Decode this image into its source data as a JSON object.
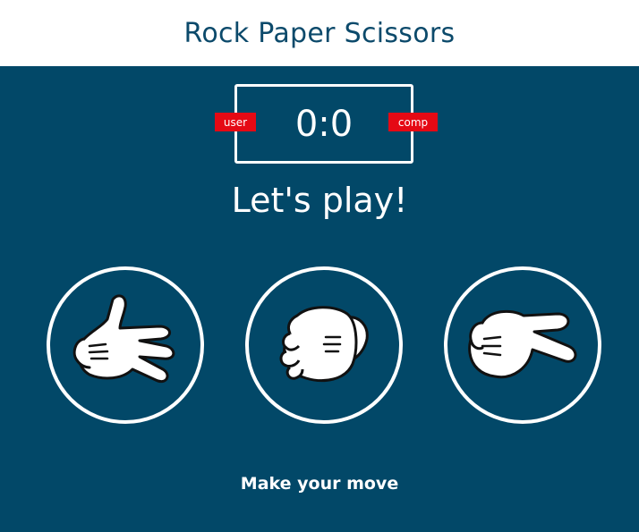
{
  "header": {
    "title": "Rock Paper Scissors"
  },
  "scoreboard": {
    "user_score": 0,
    "comp_score": 0,
    "score_text": "0:0",
    "user_label": "user",
    "comp_label": "comp"
  },
  "message": "Let's play!",
  "choices": [
    {
      "id": "paper",
      "icon": "paper-hand-icon"
    },
    {
      "id": "rock",
      "icon": "rock-fist-icon"
    },
    {
      "id": "scissors",
      "icon": "scissors-hand-icon"
    }
  ],
  "prompt": "Make your move",
  "colors": {
    "background": "#024868",
    "header_bg": "#ffffff",
    "title": "#0c4a6b",
    "badge": "#e50914",
    "border": "#ffffff"
  }
}
